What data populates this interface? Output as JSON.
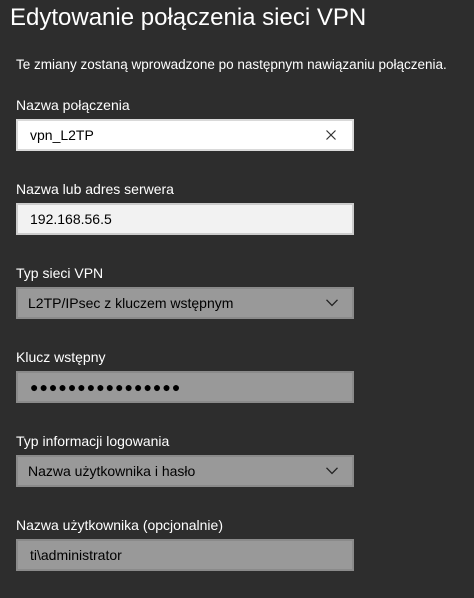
{
  "dialog": {
    "title": "Edytowanie połączenia sieci VPN",
    "subtitle": "Te zmiany zostaną wprowadzone po następnym nawiązaniu połączenia."
  },
  "connection_name": {
    "label": "Nazwa połączenia",
    "value": "vpn_L2TP",
    "clear_icon": "close-icon"
  },
  "server": {
    "label": "Nazwa lub adres serwera",
    "value": "192.168.56.5"
  },
  "vpn_type": {
    "label": "Typ sieci VPN",
    "selected": "L2TP/IPsec z kluczem wstępnym",
    "icon": "chevron-down-icon"
  },
  "preshared_key": {
    "label": "Klucz wstępny",
    "masked_value": "●●●●●●●●●●●●●●●●"
  },
  "sign_in_info": {
    "label": "Typ informacji logowania",
    "selected": "Nazwa użytkownika i hasło",
    "icon": "chevron-down-icon"
  },
  "username": {
    "label": "Nazwa użytkownika (opcjonalnie)",
    "value": "ti\\administrator"
  },
  "colors": {
    "background": "#2d2d2d",
    "field_disabled": "#999999",
    "field_light": "#f2f2f2",
    "field_active": "#ffffff"
  }
}
